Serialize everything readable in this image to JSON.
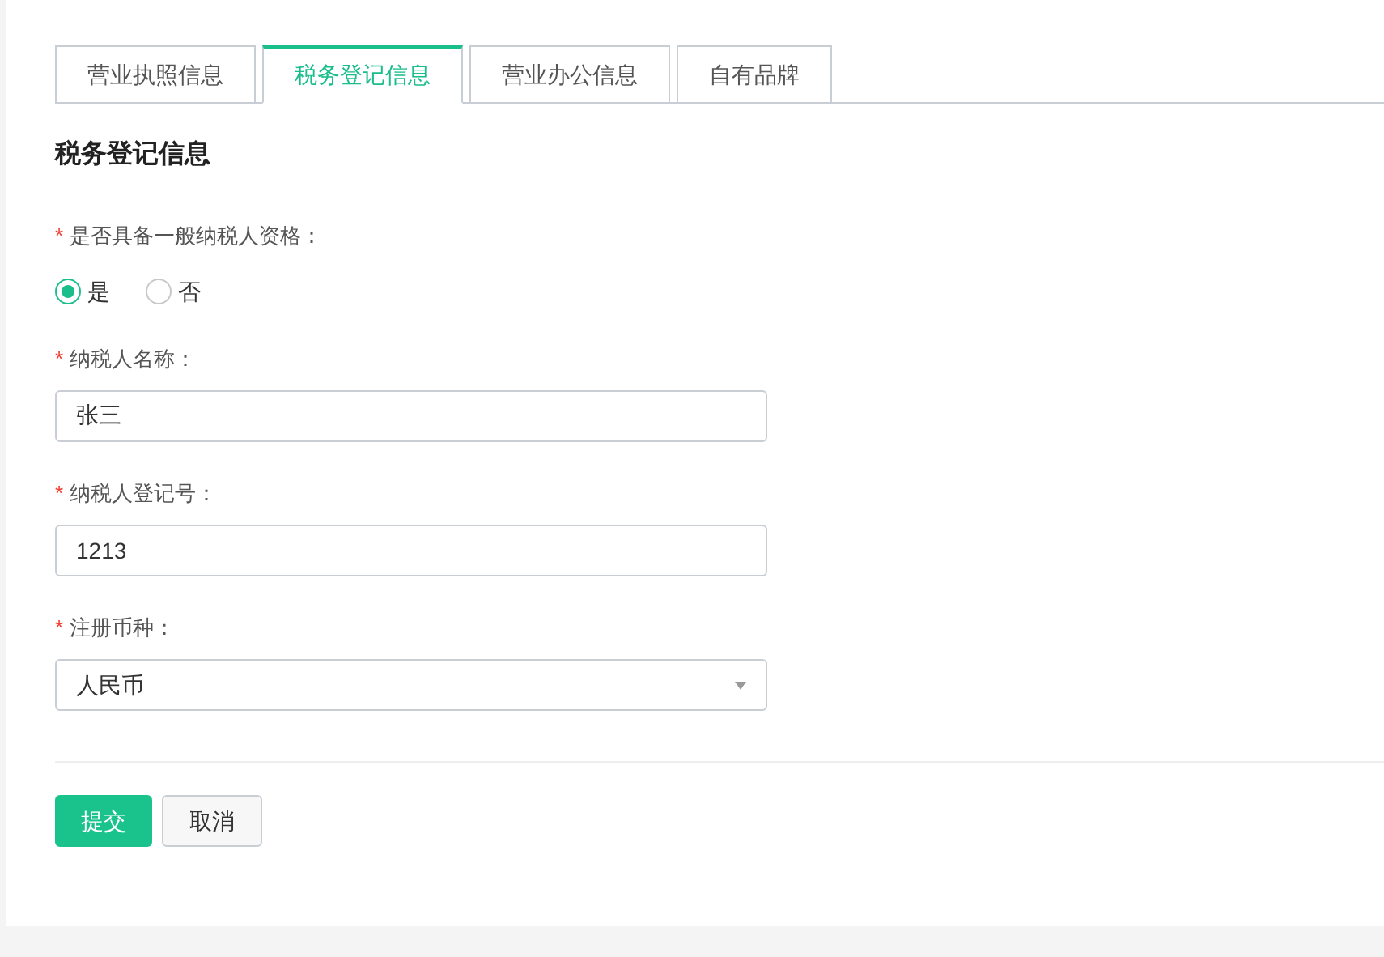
{
  "tabs": [
    {
      "label": "营业执照信息",
      "selected": false
    },
    {
      "label": "税务登记信息",
      "selected": true
    },
    {
      "label": "营业办公信息",
      "selected": false
    },
    {
      "label": "自有品牌",
      "selected": false
    }
  ],
  "section_title": "税务登记信息",
  "fields": [
    {
      "kind": "radio",
      "required_mark": "*",
      "label": "是否具备一般纳税人资格：",
      "options": [
        {
          "label": "是",
          "selected": true
        },
        {
          "label": "否",
          "selected": false
        }
      ]
    },
    {
      "kind": "text",
      "required_mark": "*",
      "label": "纳税人名称：",
      "value": "张三"
    },
    {
      "kind": "text",
      "required_mark": "*",
      "label": "纳税人登记号：",
      "value": "1213"
    },
    {
      "kind": "select",
      "required_mark": "*",
      "label": "注册币种：",
      "value": "人民币"
    }
  ],
  "buttons": [
    {
      "label": "提交",
      "kind": "primary"
    },
    {
      "label": "取消",
      "kind": "default"
    }
  ]
}
